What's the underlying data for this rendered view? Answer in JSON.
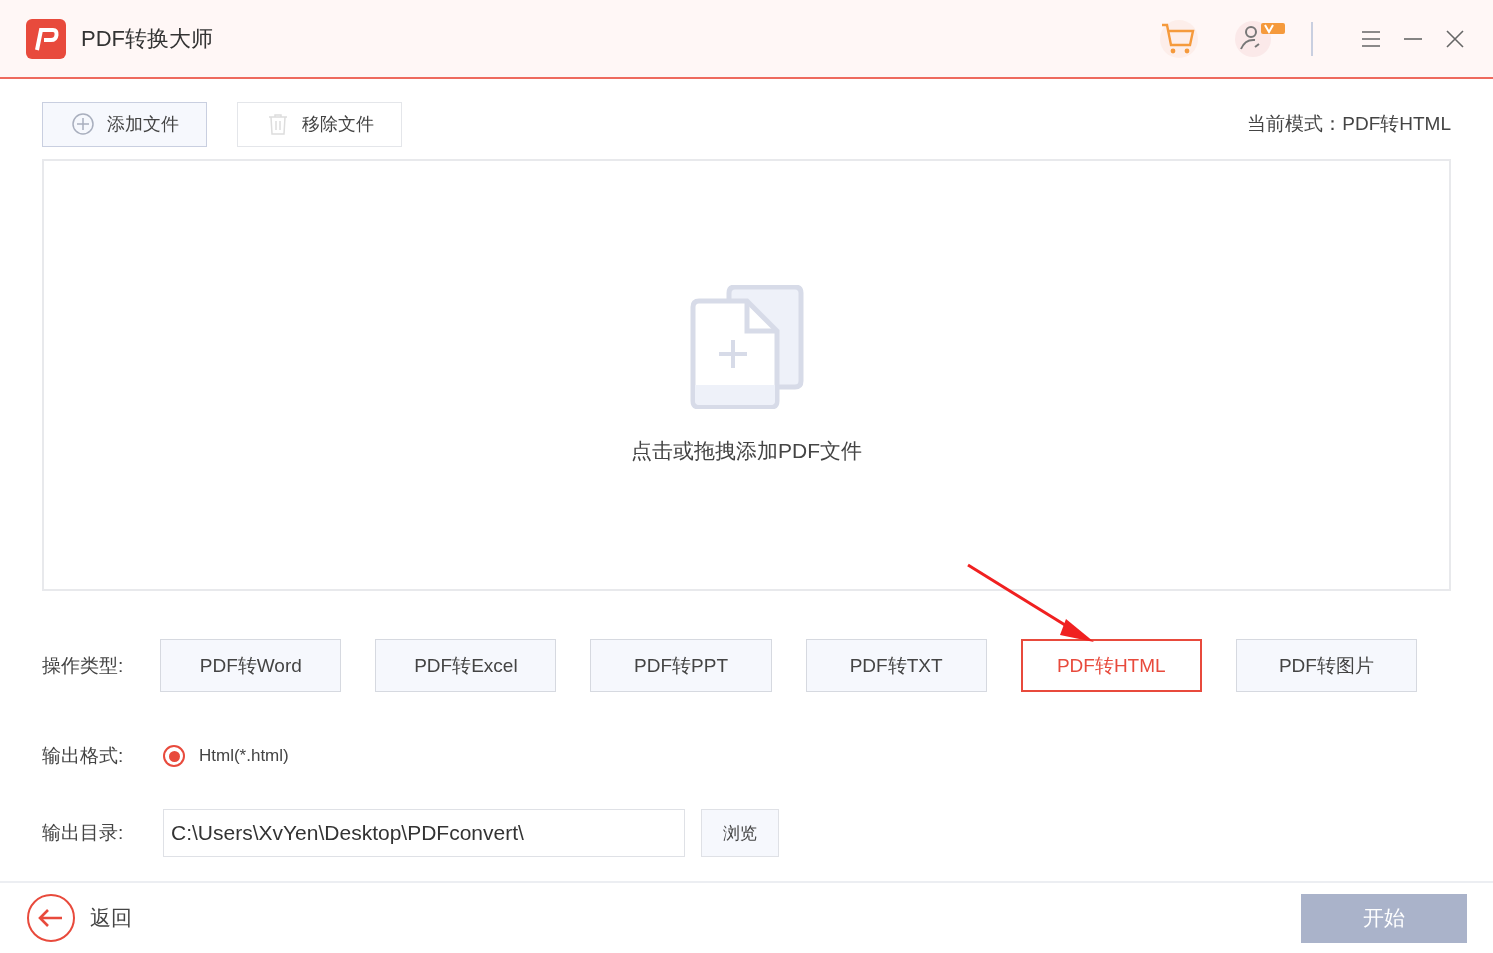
{
  "window": {
    "title": "PDF转换大师"
  },
  "toolbar": {
    "buttons": [
      {
        "label": "添加文件",
        "kind": "add"
      },
      {
        "label": "移除文件",
        "kind": "remove"
      }
    ],
    "mode": "当前模式：PDF转HTML"
  },
  "drop_area": {
    "hint": "点击或拖拽添加PDF文件"
  },
  "operation": {
    "label": "操作类型:",
    "options": [
      {
        "label": "PDF转Word",
        "selected": false
      },
      {
        "label": "PDF转Excel",
        "selected": false
      },
      {
        "label": "PDF转PPT",
        "selected": false
      },
      {
        "label": "PDF转TXT",
        "selected": false
      },
      {
        "label": "PDF转HTML",
        "selected": true
      },
      {
        "label": "PDF转图片",
        "selected": false
      }
    ]
  },
  "output_format": {
    "label": "输出格式:",
    "options": [
      {
        "label": "Html(*.html)",
        "selected": true
      }
    ]
  },
  "output_dir": {
    "label": "输出目录:",
    "value": "C:\\Users\\XvYen\\Desktop\\PDFconvert\\",
    "browse": "浏览"
  },
  "footer": {
    "back": "返回",
    "start": {
      "label": "开始",
      "disabled": true
    }
  }
}
